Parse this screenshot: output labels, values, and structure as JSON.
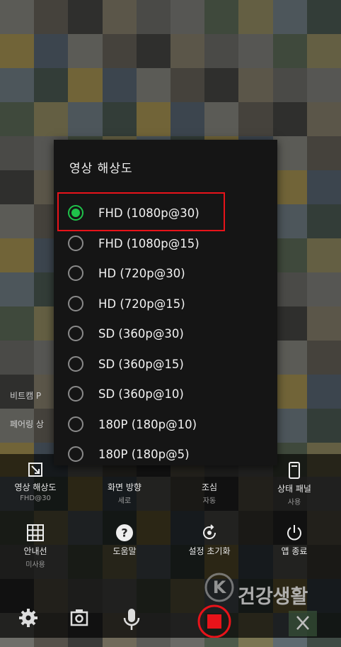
{
  "background": {
    "side_labels": [
      "비트캠 P",
      "페어링 상"
    ]
  },
  "dialog": {
    "title": "영상 해상도",
    "options": [
      {
        "label": "FHD (1080p@30)",
        "selected": true
      },
      {
        "label": "FHD (1080p@15)",
        "selected": false
      },
      {
        "label": "HD (720p@30)",
        "selected": false
      },
      {
        "label": "HD (720p@15)",
        "selected": false
      },
      {
        "label": "SD (360p@30)",
        "selected": false
      },
      {
        "label": "SD (360p@15)",
        "selected": false
      },
      {
        "label": "SD (360p@10)",
        "selected": false
      },
      {
        "label": "180P (180p@10)",
        "selected": false
      },
      {
        "label": "180P (180p@5)",
        "selected": false
      }
    ],
    "accent_color": "#1fc24a",
    "highlight_color": "#e8131a"
  },
  "controls": {
    "row1": [
      {
        "label": "영상 해상도",
        "sub": "FHD@30",
        "icon": "resize-icon"
      },
      {
        "label": "화면 방향",
        "sub": "세로",
        "icon": "screen-rotate-icon"
      },
      {
        "label": "조심",
        "sub": "자동",
        "icon": "flash-icon"
      },
      {
        "label": "상태 패널",
        "sub": "사용",
        "icon": "status-panel-icon"
      }
    ],
    "row2": [
      {
        "label": "안내선",
        "sub": "미사용",
        "icon": "grid-icon"
      },
      {
        "label": "도움말",
        "sub": "",
        "icon": "help-icon"
      },
      {
        "label": "설정 초기화",
        "sub": "",
        "icon": "reset-icon"
      },
      {
        "label": "앱 종료",
        "sub": "",
        "icon": "power-icon"
      }
    ]
  },
  "bottom_bar": {
    "icons": [
      "settings-icon",
      "camera-icon",
      "microphone-icon",
      "record-stop-icon",
      "close-icon"
    ]
  },
  "watermark": {
    "text": "건강생활",
    "letter": "K"
  }
}
